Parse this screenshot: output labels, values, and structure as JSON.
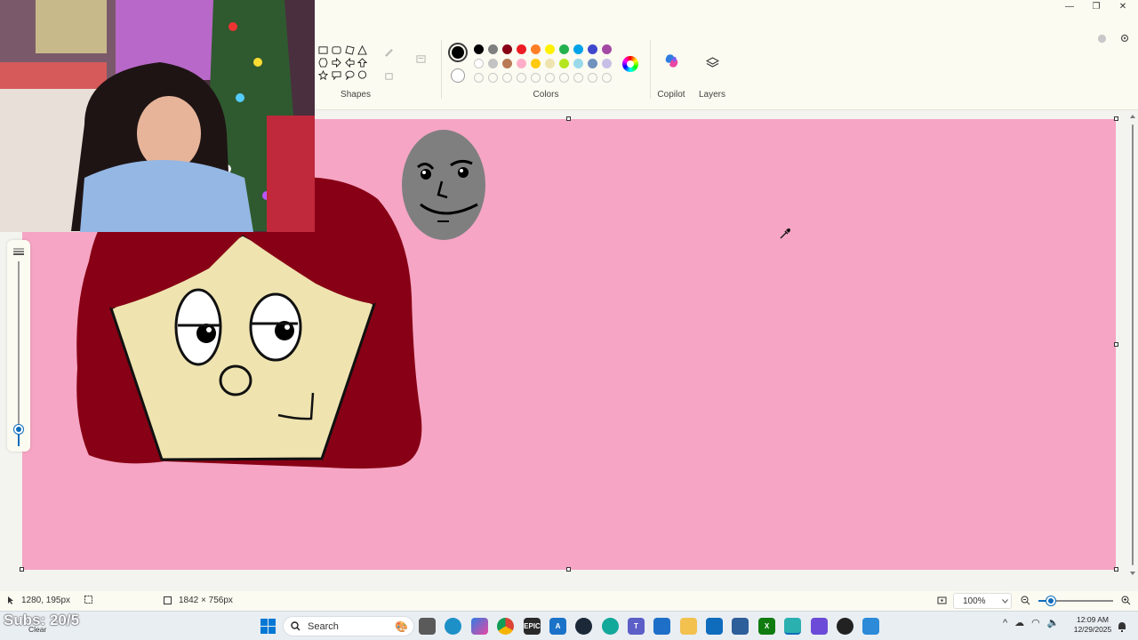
{
  "window": {
    "minimize_glyph": "—",
    "maximize_glyph": "❐",
    "close_glyph": "✕"
  },
  "ribbon": {
    "shapes_label": "Shapes",
    "colors_label": "Colors",
    "copilot_label": "Copilot",
    "layers_label": "Layers",
    "palette_row1": [
      "#000000",
      "#7f7f7f",
      "#880015",
      "#ed1c24",
      "#ff7f27",
      "#fff200",
      "#22b14c",
      "#00a2e8",
      "#3f48cc",
      "#a349a4"
    ],
    "palette_row2": [
      "#ffffff",
      "#c3c3c3",
      "#b97a57",
      "#ffaec9",
      "#ffc90e",
      "#efe4b0",
      "#b5e61d",
      "#99d9ea",
      "#7092be",
      "#c8bfe7"
    ],
    "primary_color": "#000000",
    "secondary_color": "#ffffff"
  },
  "canvas": {
    "background": "#f6a5c4"
  },
  "statusbar": {
    "cursor_position": "1280, 195px",
    "canvas_size": "1842 × 756px",
    "zoom": "100%"
  },
  "taskbar": {
    "search_placeholder": "Search",
    "weather_text": "Clear",
    "time": "12:09 AM",
    "date": "12/29/2025"
  },
  "overlay": {
    "subs_text": "Subs: 20/5"
  }
}
